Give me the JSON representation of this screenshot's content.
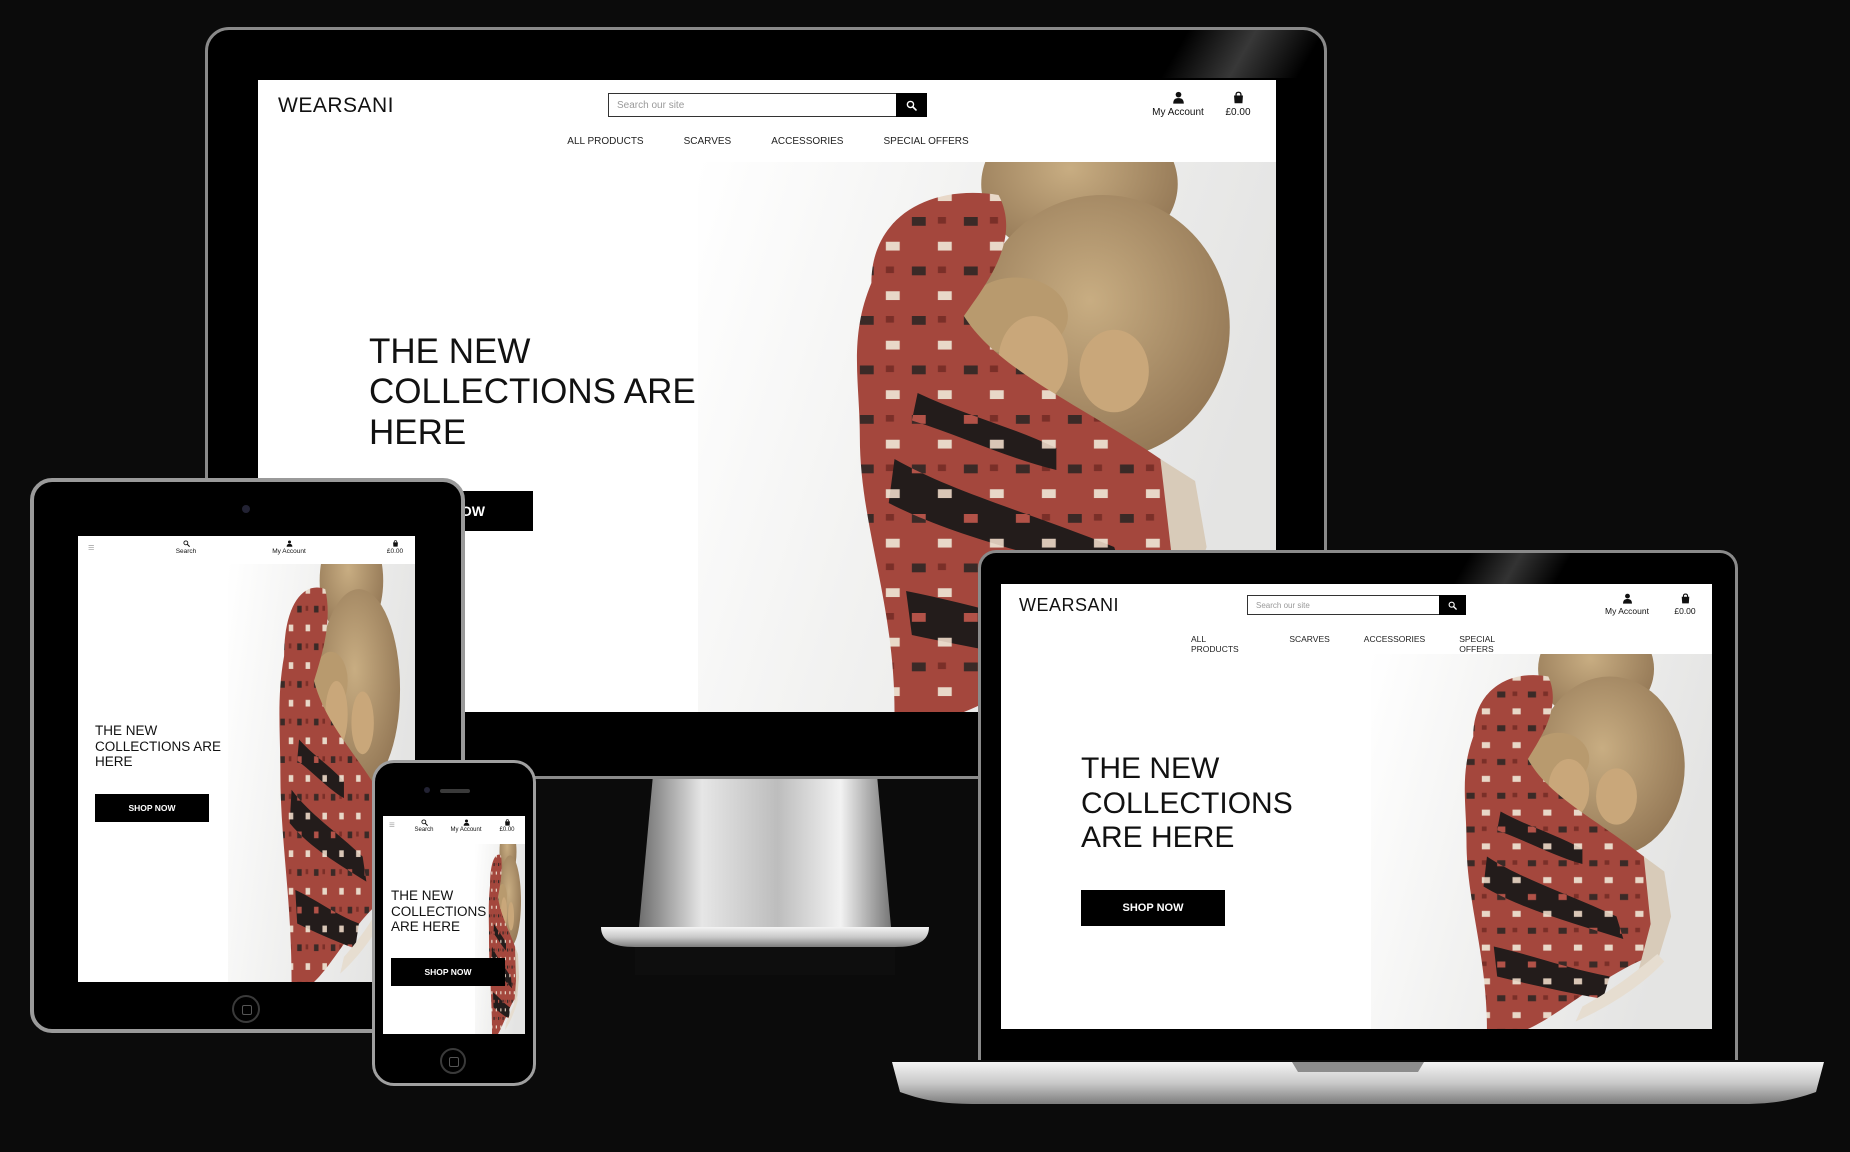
{
  "site": {
    "logo": "WEARSANI",
    "search_placeholder": "Search our site",
    "search_label": "Search",
    "account_label": "My Account",
    "cart_total": "£0.00",
    "nav": [
      "ALL PRODUCTS",
      "SCARVES",
      "ACCESSORIES",
      "SPECIAL OFFERS"
    ],
    "hero": {
      "heading": "THE NEW COLLECTIONS ARE HERE",
      "lines_wide": [
        "THE NEW",
        "COLLECTIONS ARE",
        "HERE"
      ],
      "lines_narrow": [
        "THE NEW",
        "COLLECTIONS",
        "ARE HERE"
      ],
      "cta": "SHOP NOW",
      "cta_partial": "OW"
    }
  },
  "icons": [
    "search-icon",
    "user-icon",
    "shopping-bag-icon",
    "hamburger-menu-icon"
  ],
  "colors": {
    "background": "#0b0b0b",
    "button": "#000000",
    "button_text": "#ffffff",
    "scarf": "#a4473d",
    "bear": "#a98c63"
  }
}
